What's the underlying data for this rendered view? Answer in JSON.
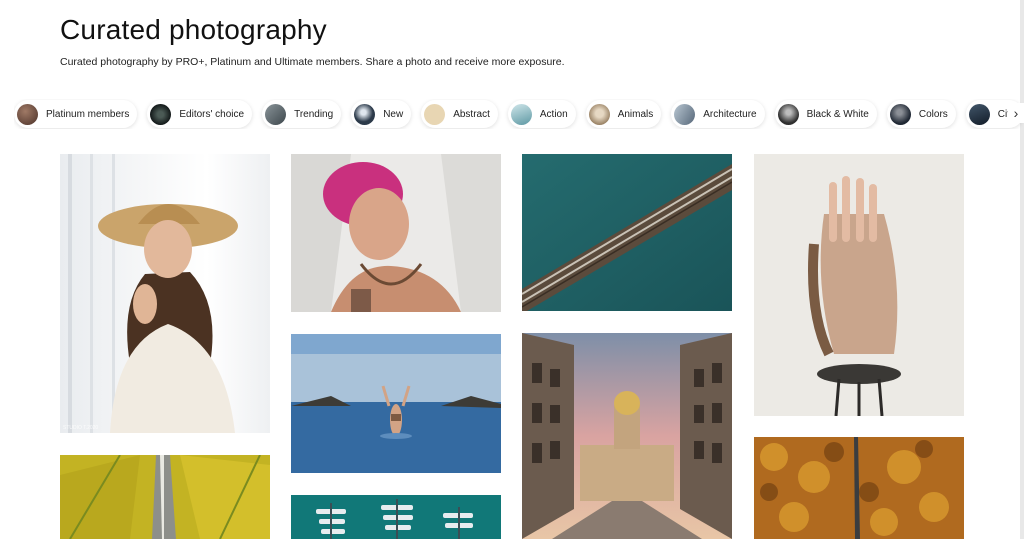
{
  "header": {
    "title": "Curated photography",
    "subtitle": "Curated photography by PRO+, Platinum and Ultimate members. Share a photo and receive more exposure."
  },
  "categories": [
    {
      "label": "Platinum members",
      "avatar": "#6b4a3e"
    },
    {
      "label": "Editors' choice",
      "avatar": "#1e2a2a"
    },
    {
      "label": "Trending",
      "avatar": "#556066"
    },
    {
      "label": "New",
      "avatar": "#2c3a4a"
    },
    {
      "label": "Abstract",
      "avatar": "#e6d3b0"
    },
    {
      "label": "Action",
      "avatar": "#7fb0b8"
    },
    {
      "label": "Animals",
      "avatar": "#b9a48a"
    },
    {
      "label": "Architecture",
      "avatar": "#7d8d99"
    },
    {
      "label": "Black & White",
      "avatar": "#444444"
    },
    {
      "label": "Colors",
      "avatar": "#2a3440"
    },
    {
      "label": "City",
      "avatar": "#223040"
    },
    {
      "label": "",
      "avatar": "#d8d2cc"
    }
  ],
  "next_icon": "chevron-right-icon",
  "gallery": {
    "photo_1_caption": "STUDIO T.2020"
  }
}
